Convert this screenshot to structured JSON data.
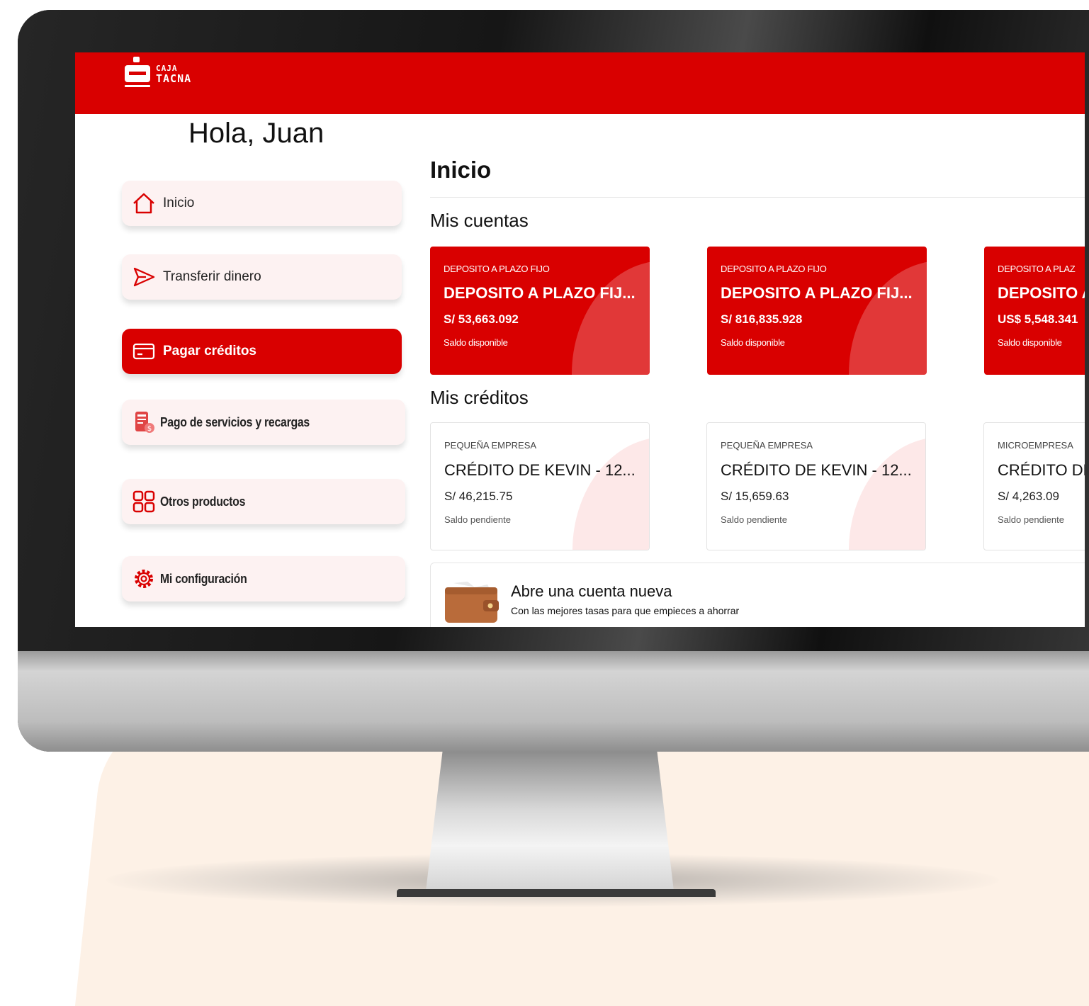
{
  "brand": {
    "line1": "CAJA",
    "line2": "TACNA",
    "accent": "#d90000"
  },
  "greeting": "Hola, Juan",
  "sidebar": {
    "items": [
      {
        "label": "Inicio",
        "icon": "home-icon",
        "active": false
      },
      {
        "label": "Transferir dinero",
        "icon": "send-icon",
        "active": false
      },
      {
        "label": "Pagar créditos",
        "icon": "credit-card-icon",
        "active": true
      },
      {
        "label": "Pago de servicios y recargas",
        "icon": "bill-payment-icon",
        "active": false
      },
      {
        "label": "Otros productos",
        "icon": "grid-icon",
        "active": false
      },
      {
        "label": "Mi configuración",
        "icon": "gear-icon",
        "active": false
      }
    ]
  },
  "main": {
    "title": "Inicio",
    "accounts_title": "Mis cuentas",
    "accounts": [
      {
        "type": "DEPOSITO A PLAZO FIJO",
        "name": "DEPOSITO A PLAZO FIJ...",
        "amount": "S/ 53,663.092",
        "label": "Saldo disponible"
      },
      {
        "type": "DEPOSITO A PLAZO FIJO",
        "name": "DEPOSITO A PLAZO FIJ...",
        "amount": "S/ 816,835.928",
        "label": "Saldo disponible"
      },
      {
        "type": "DEPOSITO A PLAZ",
        "name": "DEPOSITO A",
        "amount": "US$ 5,548.341",
        "label": "Saldo disponible"
      }
    ],
    "credits_title": "Mis créditos",
    "credits": [
      {
        "type": "PEQUEÑA EMPRESA",
        "name": "CRÉDITO DE KEVIN - 12...",
        "amount": "S/ 46,215.75",
        "label": "Saldo pendiente"
      },
      {
        "type": "PEQUEÑA EMPRESA",
        "name": "CRÉDITO DE KEVIN - 12...",
        "amount": "S/ 15,659.63",
        "label": "Saldo pendiente"
      },
      {
        "type": "MICROEMPRESA",
        "name": "CRÉDITO DE",
        "amount": "S/ 4,263.09",
        "label": "Saldo pendiente"
      }
    ],
    "promo": {
      "title": "Abre una cuenta nueva",
      "subtitle": "Con las mejores tasas para que empieces a ahorrar",
      "icon": "wallet-icon"
    }
  }
}
